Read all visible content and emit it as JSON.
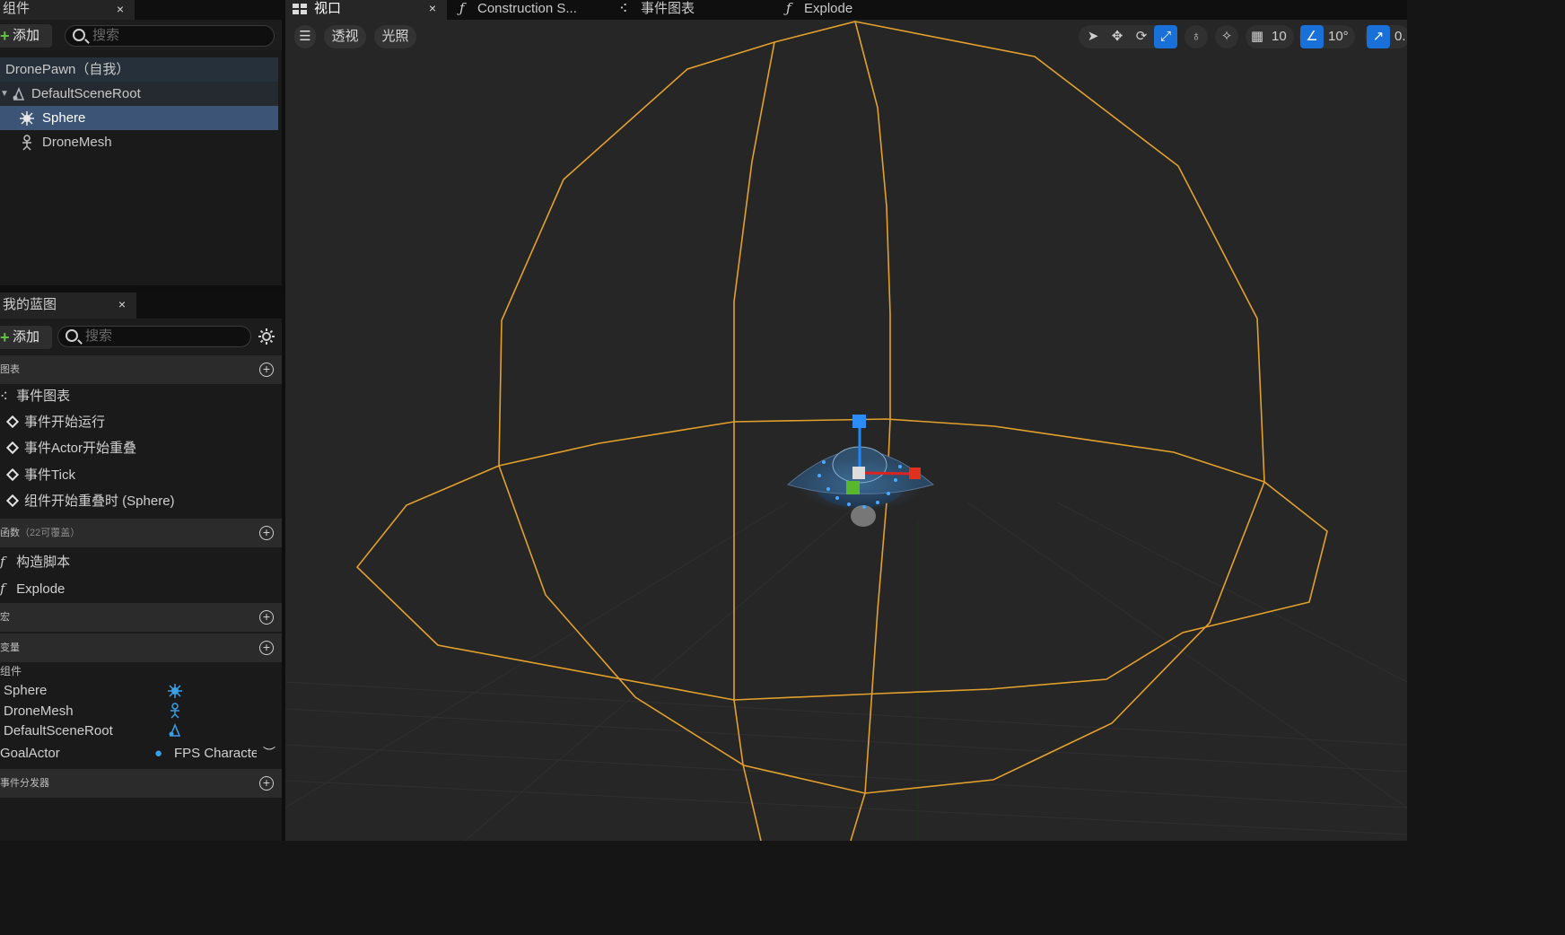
{
  "components_panel": {
    "tab_label": "组件",
    "close": "×",
    "add_label": "添加",
    "search_placeholder": "搜索",
    "tree": [
      {
        "label": "DronePawn（自我）"
      },
      {
        "label": "DefaultSceneRoot"
      },
      {
        "label": "Sphere",
        "selected": true
      },
      {
        "label": "DroneMesh"
      }
    ]
  },
  "my_blueprint": {
    "tab_label": "我的蓝图",
    "close": "×",
    "add_label": "添加",
    "search_placeholder": "搜索",
    "sections": {
      "graphs": {
        "label": "图表",
        "items": [
          "事件图表"
        ]
      },
      "events": [
        "事件开始运行",
        "事件Actor开始重叠",
        "事件Tick",
        "组件开始重叠时 (Sphere)"
      ],
      "functions": {
        "label": "函数",
        "count": "（22可覆盖）",
        "items": [
          "构造脚本",
          "Explode"
        ]
      },
      "macros": {
        "label": "宏"
      },
      "variables": {
        "label": "变量"
      },
      "var_group": "组件",
      "vars": [
        {
          "name": "Sphere"
        },
        {
          "name": "DroneMesh"
        },
        {
          "name": "DefaultSceneRoot"
        },
        {
          "name": "GoalActor",
          "type": "FPS Characte"
        }
      ],
      "dispatchers": {
        "label": "事件分发器"
      }
    }
  },
  "viewport": {
    "tabs": [
      {
        "label": "视口",
        "active": true,
        "close": "×"
      },
      {
        "label": "Construction S..."
      },
      {
        "label": "事件图表"
      },
      {
        "label": "Explode"
      }
    ],
    "left_buttons": {
      "perspective": "透视",
      "lighting": "光照"
    },
    "grid_value": "10",
    "angle_value": "10°",
    "scale_value": "0."
  }
}
